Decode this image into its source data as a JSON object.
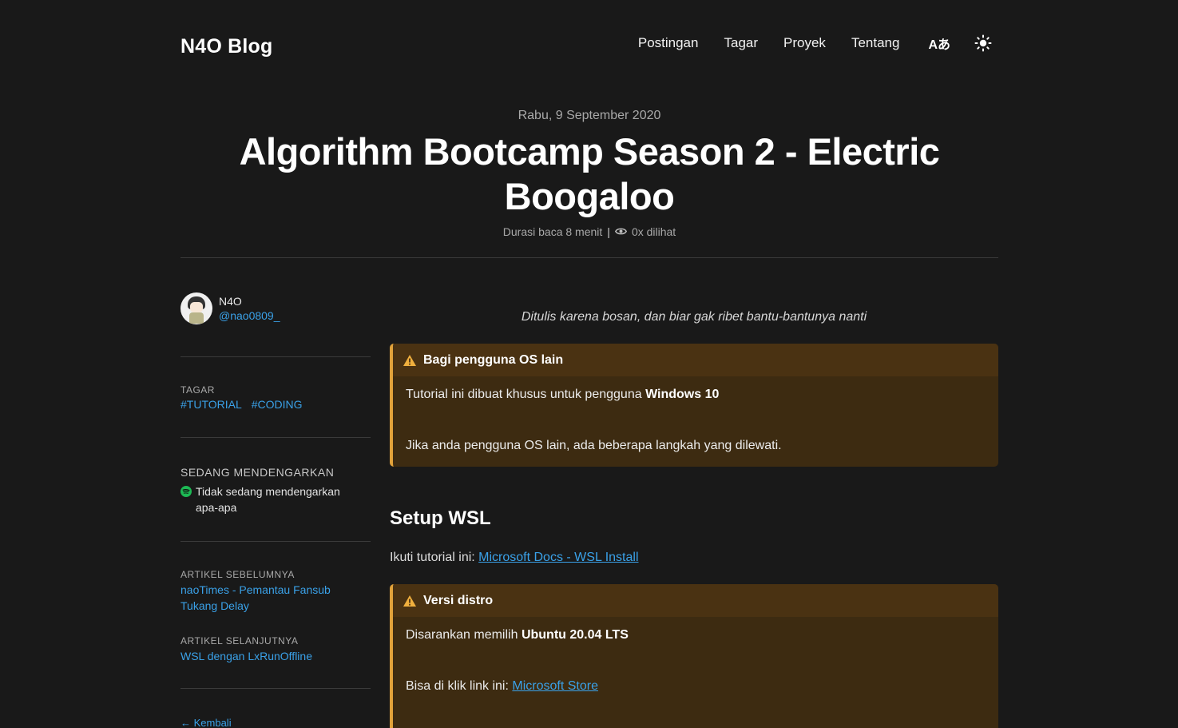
{
  "site": {
    "brand": "N4O Blog",
    "nav": [
      "Postingan",
      "Tagar",
      "Proyek",
      "Tentang"
    ],
    "lang_label": "Aあ",
    "theme_icon": "sun-icon"
  },
  "post": {
    "date": "Rabu, 9 September 2020",
    "title_line1": "Algorithm Bootcamp Season 2 - Electric",
    "title_line2": "Boogaloo",
    "read_time": "Durasi baca 8 menit",
    "separator": "|",
    "views": "0x dilihat"
  },
  "sidebar": {
    "author_name": "N4O",
    "author_handle": "@nao0809_",
    "tags_label": "TAGAR",
    "tags": [
      "#TUTORIAL",
      "#CODING"
    ],
    "listening_label": "SEDANG MENDENGARKAN",
    "listening_line1": "Tidak sedang mendengarkan",
    "listening_line2": "apa-apa",
    "prev_label": "ARTIKEL SEBELUMNYA",
    "prev_line1": "naoTimes - Pemantau Fansub",
    "prev_line2": "Tukang Delay",
    "next_label": "ARTIKEL SELANJUTNYA",
    "next_title": "WSL dengan LxRunOffline",
    "back": "← Kembali"
  },
  "content": {
    "quote": "Ditulis karena bosan, dan biar gak ribet bantu-bantunya nanti",
    "callout1": {
      "title": "Bagi pengguna OS lain",
      "line1_prefix": "Tutorial ini dibuat khusus untuk pengguna ",
      "line1_bold": "Windows 10",
      "line2": "Jika anda pengguna OS lain, ada beberapa langkah yang dilewati."
    },
    "heading": "Setup WSL",
    "para_prefix": "Ikuti tutorial ini: ",
    "para_link": "Microsoft Docs - WSL Install",
    "callout2": {
      "title": "Versi distro",
      "line1_prefix": "Disarankan memilih ",
      "line1_bold": "Ubuntu 20.04 LTS",
      "line2_prefix": "Bisa di klik link ini: ",
      "line2_link": "Microsoft Store"
    }
  },
  "colors": {
    "background": "#191919",
    "link": "#3aa1e8",
    "callout_bg": "#3d2b11",
    "callout_accent": "#e1a23a",
    "spotify": "#1db954"
  }
}
